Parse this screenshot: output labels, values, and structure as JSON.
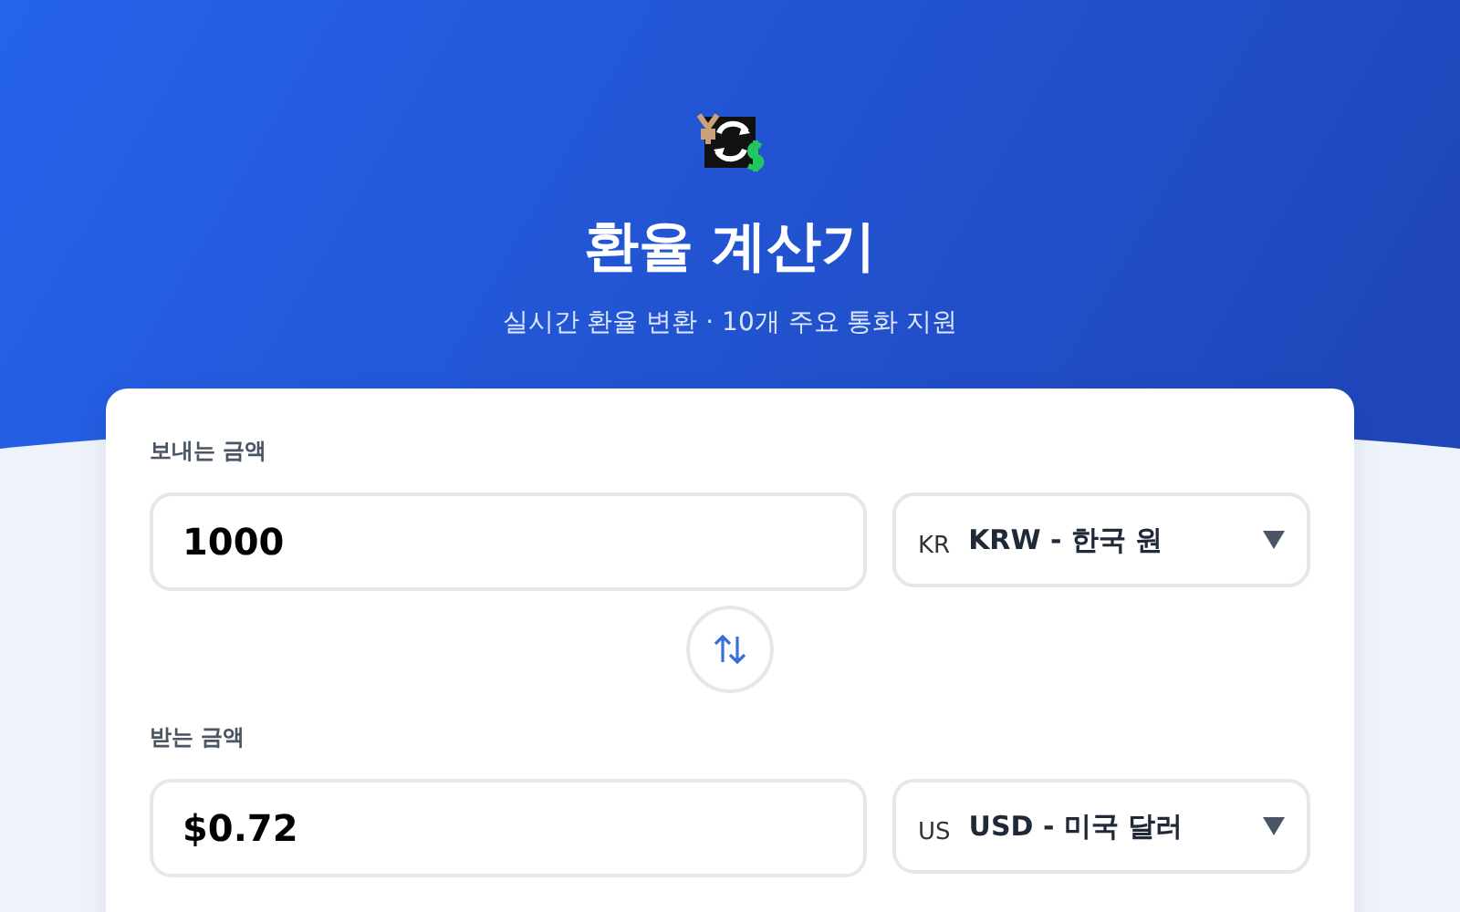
{
  "header": {
    "title": "환율 계산기",
    "subtitle": "실시간 환율 변환 · 10개 주요 통화 지원"
  },
  "converter": {
    "from": {
      "label": "보내는 금액",
      "value": "1000",
      "currency_code": "KR",
      "currency": "KRW - 한국 원"
    },
    "to": {
      "label": "받는 금액",
      "value": "$0.72",
      "currency_code": "US",
      "currency": "USD - 미국 달러"
    }
  }
}
